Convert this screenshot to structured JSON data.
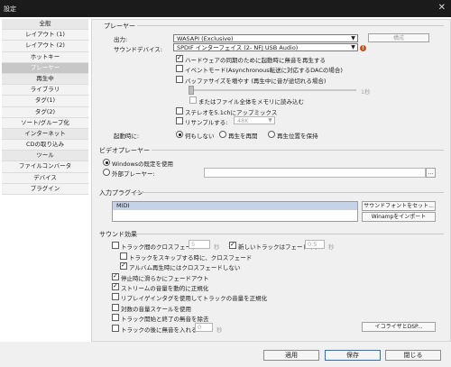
{
  "window": {
    "title": "設定",
    "close_icon": "close-icon"
  },
  "sidebar": {
    "items": [
      {
        "label": "全般",
        "type": "header"
      },
      {
        "label": "レイアウト (1)",
        "type": "item"
      },
      {
        "label": "レイアウト (2)",
        "type": "item"
      },
      {
        "label": "ホットキー",
        "type": "item"
      },
      {
        "label": "プレーヤー",
        "type": "selected"
      },
      {
        "label": "再生中",
        "type": "header"
      },
      {
        "label": "ライブラリ",
        "type": "item"
      },
      {
        "label": "タグ(1)",
        "type": "item"
      },
      {
        "label": "タグ(2)",
        "type": "item"
      },
      {
        "label": "ソート/グループ化",
        "type": "item"
      },
      {
        "label": "インターネット",
        "type": "header"
      },
      {
        "label": "CDの取り込み",
        "type": "item"
      },
      {
        "label": "ツール",
        "type": "header"
      },
      {
        "label": "ファイルコンバータ",
        "type": "item"
      },
      {
        "label": "デバイス",
        "type": "item"
      },
      {
        "label": "プラグイン",
        "type": "item"
      }
    ]
  },
  "player": {
    "group_label": "プレーヤー",
    "output_label": "出力:",
    "output_value": "WASAPI (Exclusive)",
    "device_label": "サウンドデバイス:",
    "device_value": "SPDIF インターフェイス (2- NFJ USB Audio)",
    "configure_button": "構成",
    "warn_icon": "warning-icon",
    "hw_init_label": "ハードウェアの同期のために起動時に無音を再生する",
    "event_mode_label": "イベントモード(Asynchronous転送に対応するDACの場合)",
    "buffer_label": "バッファサイズを増やす (再生中に音が途切れる場合)",
    "buffer_slider_value": "1秒",
    "load_whole_label": "またはファイル全体をメモリに読み込む",
    "stereo_upmix_label": "ステレオを5.1chにアップミックス",
    "resample_label": "リサンプルする:",
    "resample_value": "48K",
    "startup_label": "起動時に:",
    "startup_options": [
      "何もしない",
      "再生を再開",
      "再生位置を保持"
    ]
  },
  "video": {
    "group_label": "ビデオプレーヤー",
    "option_windows": "Windowsの既定を使用",
    "option_external": "外部プレーヤー:",
    "path_value": "",
    "browse_label": "..."
  },
  "input_plugins": {
    "group_label": "入力プラグイン",
    "items": [
      "MIDI"
    ],
    "soundfont_button": "サウンドフォントをセット...",
    "winamp_button": "Winampをインポート"
  },
  "sound_effects": {
    "group_label": "サウンド効果",
    "crossfade_label": "トラック間のクロスフェード:",
    "crossfade_value": "5",
    "crossfade_unit": "秒",
    "fadein_label": "新しいトラックはフェードイン",
    "fadein_value": "0.5",
    "fadein_unit": "秒",
    "skip_crossfade_label": "トラックをスキップする時に、クロスフェード",
    "album_no_crossfade_label": "アルバム再生時にはクロスフェードしない",
    "pause_fadeout_label": "停止時に滑らかにフェードアウト",
    "normalize_label": "ストリームの音量を動的に正規化",
    "replaygain_label": "リプレイゲインタグを使用してトラックの音量を正規化",
    "log_scale_label": "対数の音量スケールを使用",
    "trim_silence_label": "トラック開始と終了の無音を除去",
    "insert_silence_label": "トラックの後に無音を入れる",
    "insert_silence_value": "0",
    "insert_silence_unit": "秒",
    "equalizer_button": "イコライザとDSP..."
  },
  "footer": {
    "apply_label": "適用",
    "save_label": "保存",
    "close_label": "閉じる"
  }
}
